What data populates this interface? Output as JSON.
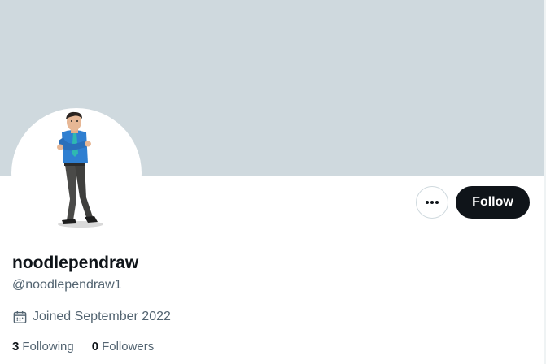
{
  "profile": {
    "display_name": "noodlependraw",
    "handle": "@noodlependraw1",
    "joined": "Joined September 2022",
    "following_count": "3",
    "following_label": "Following",
    "followers_count": "0",
    "followers_label": "Followers"
  },
  "actions": {
    "follow_label": "Follow",
    "more_icon": "more-horizontal-icon"
  },
  "colors": {
    "banner": "#cfd9de",
    "follow_button_bg": "#0f1419",
    "secondary_text": "#536471"
  }
}
